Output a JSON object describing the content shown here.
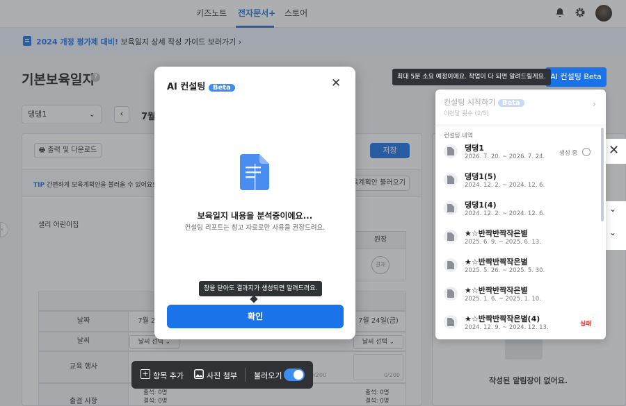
{
  "nav": {
    "tabs": [
      "키즈노트",
      "전자문서+",
      "스토어"
    ]
  },
  "banner": {
    "highlight": "2024 개정 평가제 대비!",
    "text": " 보육일지 상세 작성 가이드 보러가기 ›"
  },
  "page": {
    "title": "기본보육일지",
    "class_select": "댕댕1",
    "date_prefix": "7월",
    "print_label": "출력 및 다운로드",
    "save_label": "저장",
    "tip_label": "TIP",
    "tip_text": "간편하게 보육계획안을 불러올 수 있어요!",
    "load_plan_label": "육계획안 불러오기",
    "school_name": "샐리 어린이집",
    "principal_label": "원장",
    "approve_label": "결재",
    "row_labels": [
      "날짜",
      "날씨",
      "교육 행사",
      "출결 사항"
    ],
    "date_first": "7월 20",
    "date_last": "7월 24일(금)",
    "weather_select": "날씨 선택",
    "counter": "0/200",
    "attend": "출석: 0명",
    "absent": "결석: 0명",
    "empty_notice": "작성된 알림장이 없어요."
  },
  "ai": {
    "button_label": "AI 컨설팅 Beta",
    "hint": "최대 5분 소요 예정이에요. 작업이 다 되면 알려드릴게요."
  },
  "modal": {
    "title": "AI 컨설팅",
    "beta": "Beta",
    "heading": "보육일지 내용을 분석중이에요...",
    "sub": "컨설팅 리포트는 참고 자료로만 사용을 권장드려요.",
    "tooltip": "창을 닫아도 결과지가 생성되면 알려드려요.",
    "confirm": "확인"
  },
  "history": {
    "start_label": "컨설팅 시작하기",
    "start_beta": "Beta",
    "start_sub": "이번달 횟수 (2/5)",
    "section": "컨설팅 내역",
    "items": [
      {
        "title": "댕댕1",
        "date": "2026. 7. 20. ~ 2026. 7. 24.",
        "status": "생성 중"
      },
      {
        "title": "댕댕1(5)",
        "date": "2024. 12. 2. ~ 2024. 12. 6.",
        "status": ""
      },
      {
        "title": "댕댕1(4)",
        "date": "2024. 12. 2. ~ 2024. 12. 6.",
        "status": ""
      },
      {
        "title": "★☆반짝반짝작은별",
        "date": "2025. 6. 9. ~ 2025. 6. 13.",
        "status": ""
      },
      {
        "title": "★☆반짝반짝작은별",
        "date": "2025. 5. 26. ~ 2025. 5. 30.",
        "status": ""
      },
      {
        "title": "★☆반짝반짝작은별",
        "date": "2025. 1. 6. ~ 2025. 1. 10.",
        "status": ""
      },
      {
        "title": "★☆반짝반짝작은별(4)",
        "date": "2024. 12. 9. ~ 2024. 12. 13.",
        "status": "실패"
      }
    ]
  },
  "toolbar": {
    "add_item": "항목 추가",
    "attach_photo": "사진 첨부",
    "load": "불러오기"
  },
  "colors": {
    "accent": "#1a73e8",
    "fail": "#e53935"
  }
}
